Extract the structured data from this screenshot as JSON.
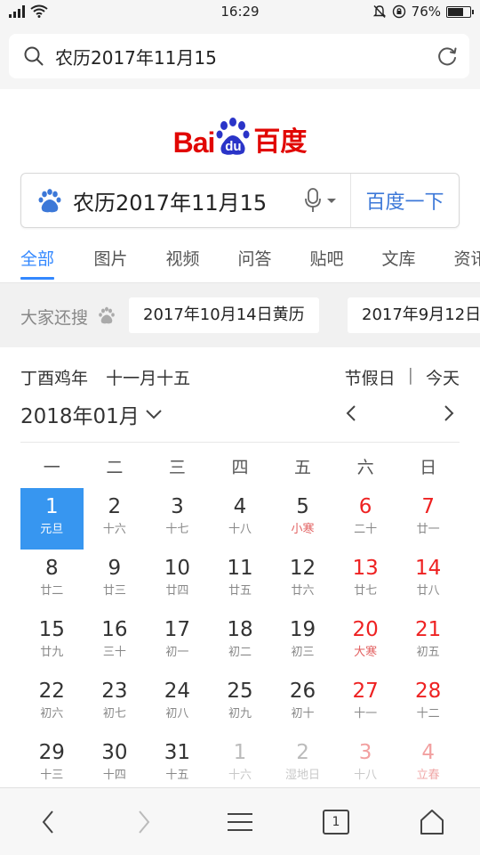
{
  "status": {
    "time": "16:29",
    "battery_text": "76%",
    "battery_level": 0.76
  },
  "browser": {
    "address_text": "农历2017年11月15"
  },
  "logo": {
    "bai": "Bai",
    "du": "du",
    "cn": "百度"
  },
  "search": {
    "query": "农历2017年11月15",
    "button_label": "百度一下"
  },
  "tabs": [
    "全部",
    "图片",
    "视频",
    "问答",
    "贴吧",
    "文库",
    "资讯"
  ],
  "others_search": {
    "label": "大家还搜",
    "items": [
      "2017年10月14日黄历",
      "2017年9月12日"
    ]
  },
  "calendar": {
    "lunar_year": "丁酉鸡年",
    "lunar_date": "十一月十五",
    "holidays_label": "节假日",
    "separator": "|",
    "today_label": "今天",
    "month_label": "2018年01月",
    "weekdays": [
      "一",
      "二",
      "三",
      "四",
      "五",
      "六",
      "日"
    ],
    "weeks": [
      [
        {
          "num": "1",
          "sub": "元旦",
          "selected": true,
          "festival": true
        },
        {
          "num": "2",
          "sub": "十六"
        },
        {
          "num": "3",
          "sub": "十七"
        },
        {
          "num": "4",
          "sub": "十八"
        },
        {
          "num": "5",
          "sub": "小寒",
          "festival": true
        },
        {
          "num": "6",
          "sub": "二十",
          "weekend": true
        },
        {
          "num": "7",
          "sub": "廿一",
          "weekend": true
        }
      ],
      [
        {
          "num": "8",
          "sub": "廿二"
        },
        {
          "num": "9",
          "sub": "廿三"
        },
        {
          "num": "10",
          "sub": "廿四"
        },
        {
          "num": "11",
          "sub": "廿五"
        },
        {
          "num": "12",
          "sub": "廿六"
        },
        {
          "num": "13",
          "sub": "廿七",
          "weekend": true
        },
        {
          "num": "14",
          "sub": "廿八",
          "weekend": true
        }
      ],
      [
        {
          "num": "15",
          "sub": "廿九"
        },
        {
          "num": "16",
          "sub": "三十"
        },
        {
          "num": "17",
          "sub": "初一"
        },
        {
          "num": "18",
          "sub": "初二"
        },
        {
          "num": "19",
          "sub": "初三"
        },
        {
          "num": "20",
          "sub": "大寒",
          "weekend": true,
          "festival": true
        },
        {
          "num": "21",
          "sub": "初五",
          "weekend": true
        }
      ],
      [
        {
          "num": "22",
          "sub": "初六"
        },
        {
          "num": "23",
          "sub": "初七"
        },
        {
          "num": "24",
          "sub": "初八"
        },
        {
          "num": "25",
          "sub": "初九"
        },
        {
          "num": "26",
          "sub": "初十"
        },
        {
          "num": "27",
          "sub": "十一",
          "weekend": true
        },
        {
          "num": "28",
          "sub": "十二",
          "weekend": true
        }
      ],
      [
        {
          "num": "29",
          "sub": "十三"
        },
        {
          "num": "30",
          "sub": "十四"
        },
        {
          "num": "31",
          "sub": "十五"
        },
        {
          "num": "1",
          "sub": "十六",
          "other": true
        },
        {
          "num": "2",
          "sub": "湿地日",
          "other": true
        },
        {
          "num": "3",
          "sub": "十八",
          "other": true,
          "weekend": true
        },
        {
          "num": "4",
          "sub": "立春",
          "other": true,
          "weekend": true,
          "festival": true
        }
      ]
    ]
  },
  "bottom_nav": {
    "tab_count": "1"
  },
  "colors": {
    "brand_red": "#e10602",
    "brand_blue": "#2a34c8",
    "link_blue": "#3388ff",
    "selected_day": "#3796f0",
    "weekend_red": "#e22"
  }
}
